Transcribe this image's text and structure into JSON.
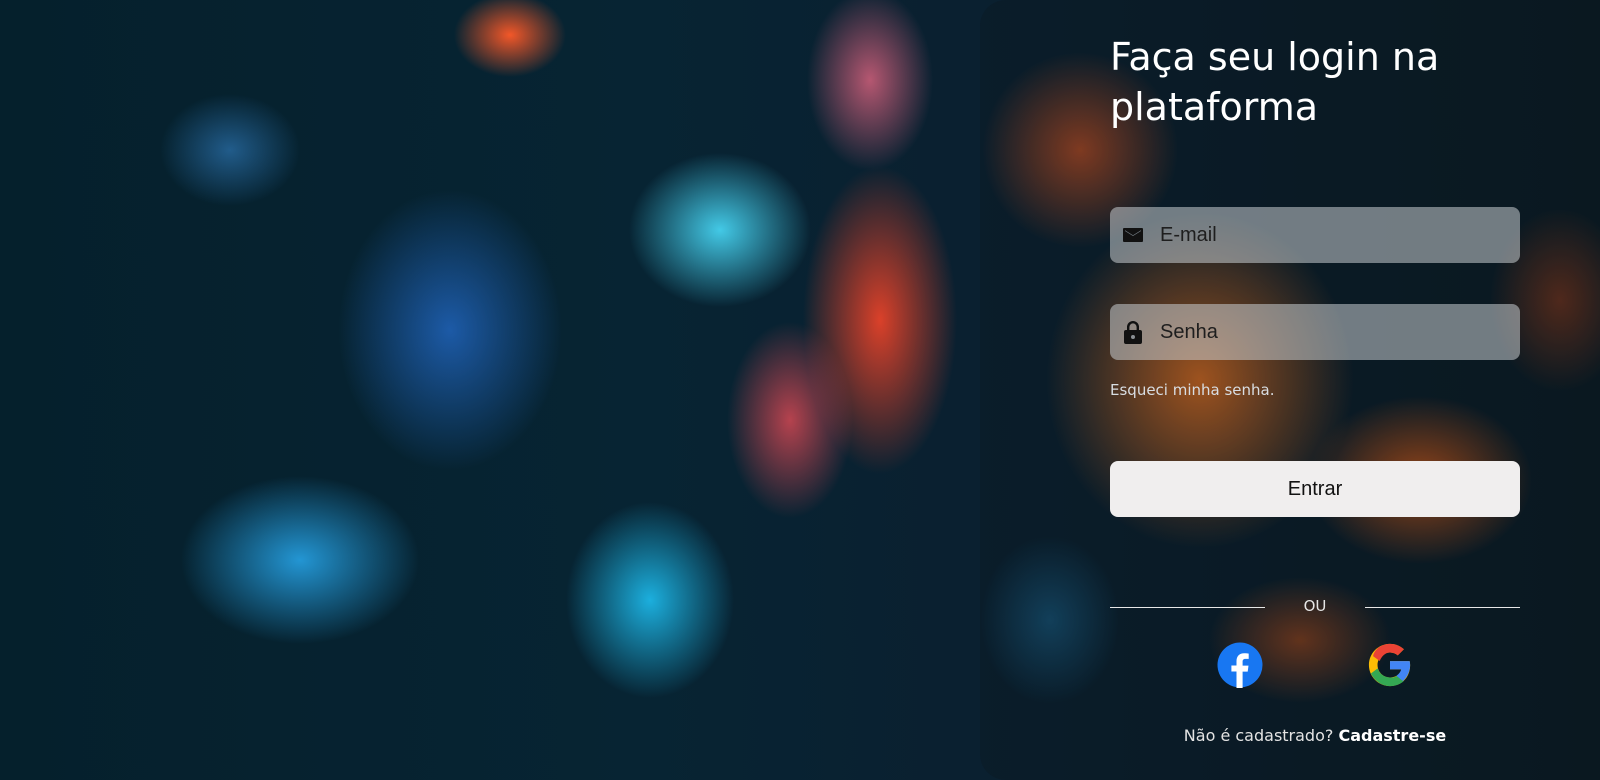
{
  "login": {
    "title": "Faça seu login na plataforma",
    "email": {
      "placeholder": "E-mail",
      "value": "",
      "icon": "mail-icon"
    },
    "password": {
      "placeholder": "Senha",
      "value": "",
      "icon": "lock-icon"
    },
    "forgot_password": "Esqueci minha senha.",
    "submit_label": "Entrar",
    "divider_label": "OU",
    "social": [
      {
        "name": "facebook",
        "icon": "facebook-icon",
        "color": "#1877F2"
      },
      {
        "name": "google",
        "icon": "google-icon",
        "colors": [
          "#4285F4",
          "#EA4335",
          "#FBBC05",
          "#34A853"
        ]
      }
    ],
    "signup_prompt": "Não é cadastrado?",
    "signup_link": "Cadastre-se"
  }
}
